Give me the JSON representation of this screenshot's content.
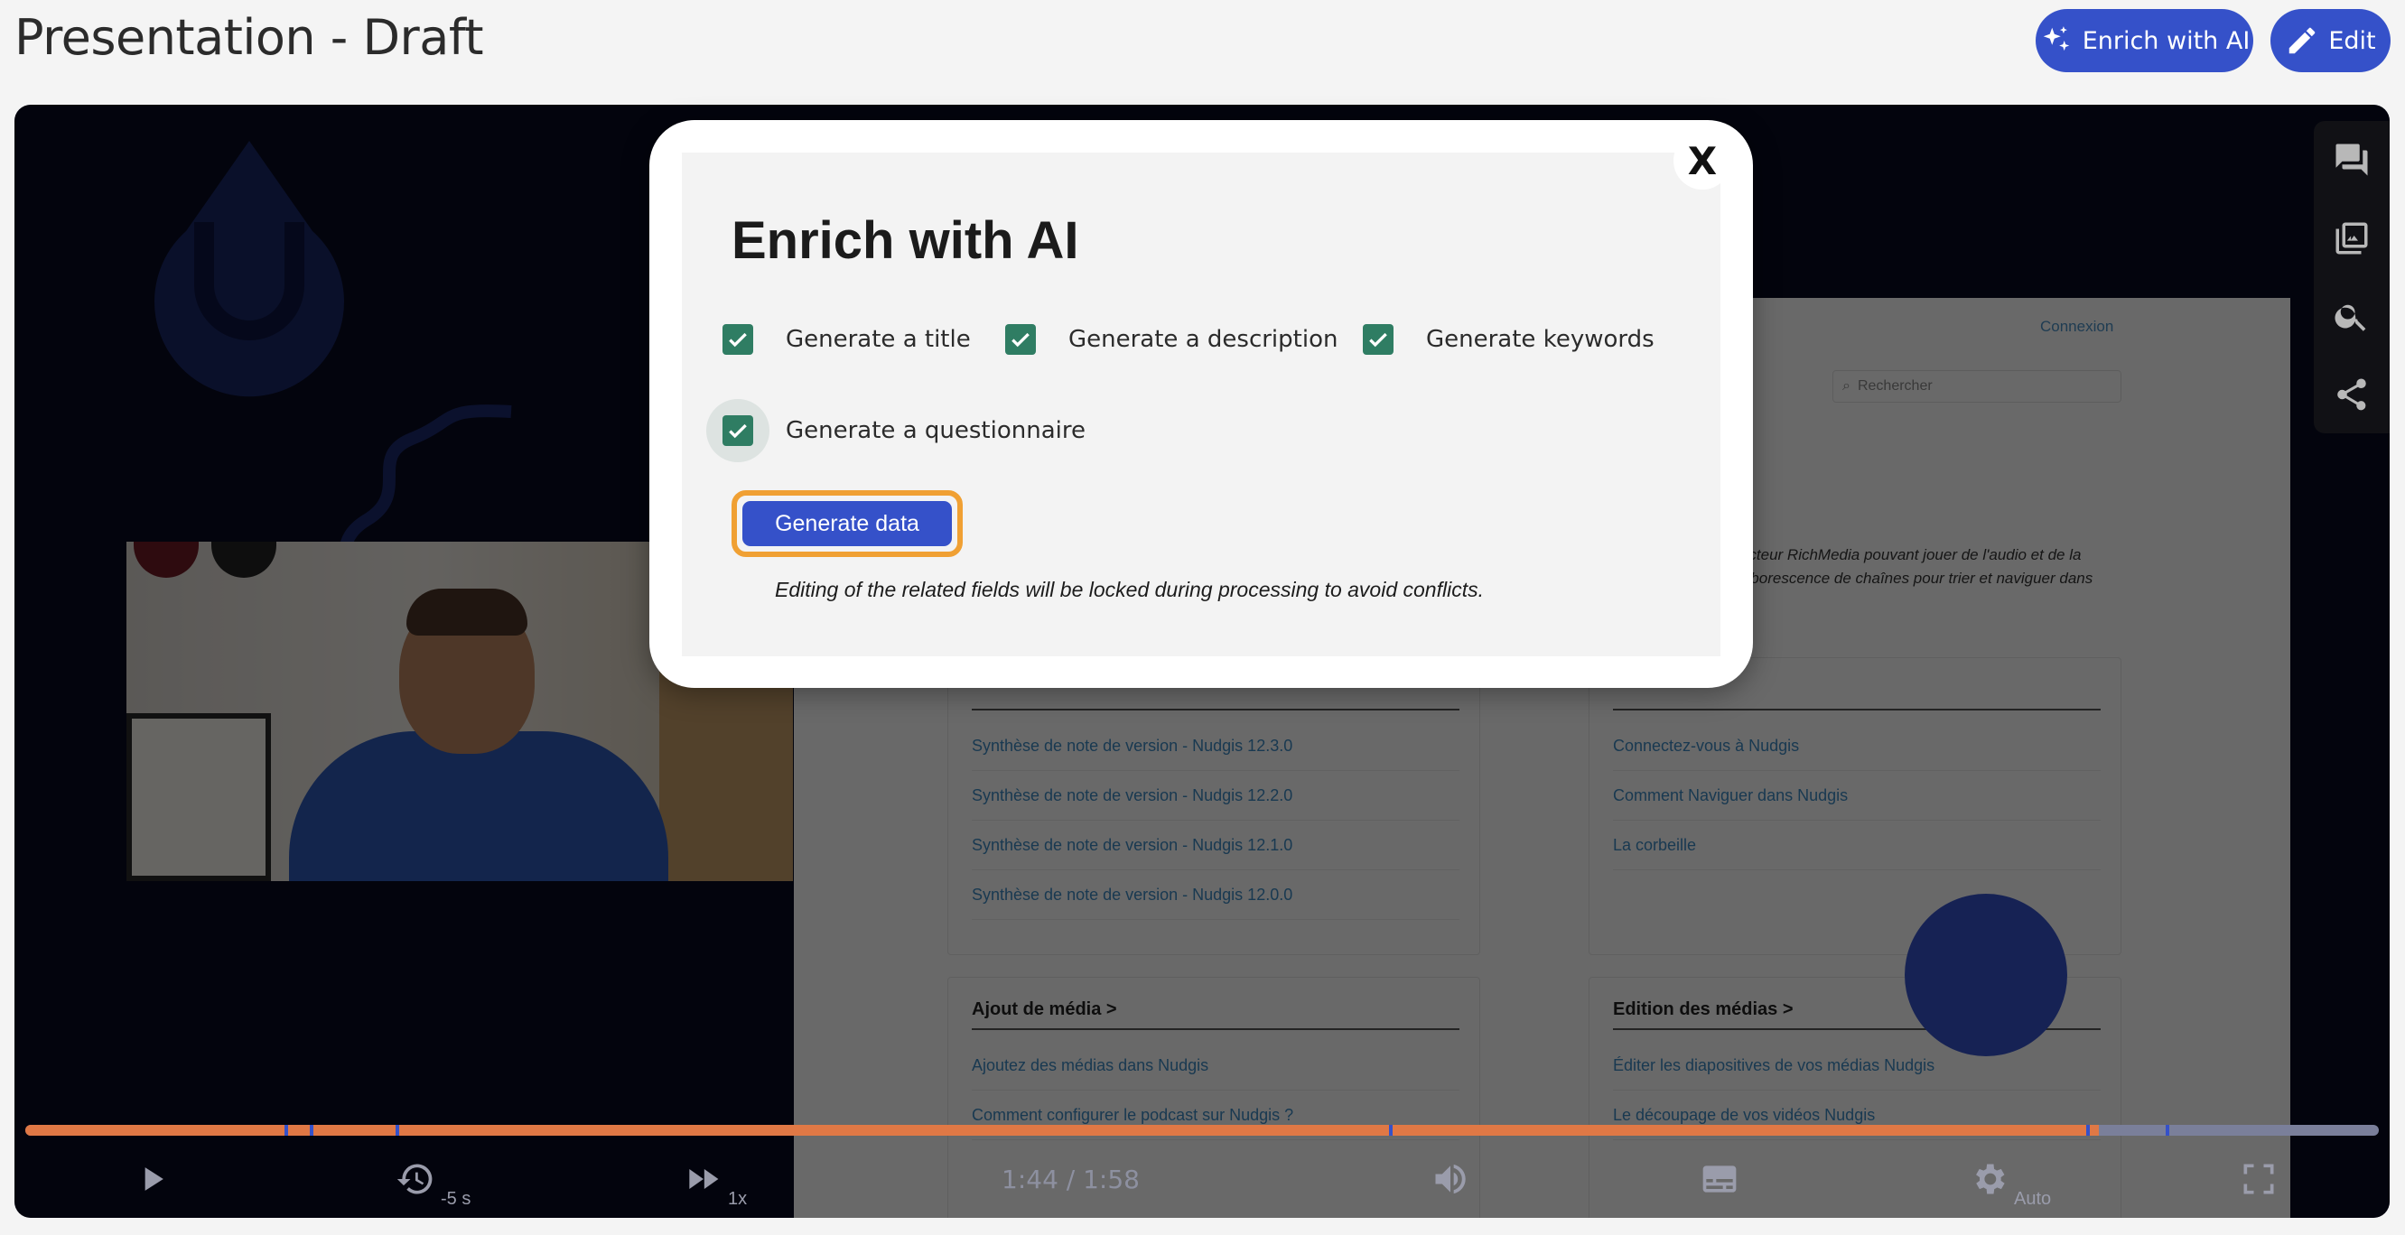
{
  "header": {
    "title": "Presentation - Draft",
    "enrich_label": "Enrich with AI",
    "edit_label": "Edit",
    "accent_color": "#3551c9"
  },
  "player": {
    "slide": {
      "connexion": "Connexion",
      "search_placeholder": "Rechercher",
      "intro_lines": [
        "n lecteur RichMedia pouvant jouer de l'audio et de la",
        "e arborescence de chaînes pour trier et naviguer dans"
      ],
      "cards": [
        {
          "title": "",
          "links": [
            "Synthèse de note de version - Nudgis 12.3.0",
            "Synthèse de note de version - Nudgis 12.2.0",
            "Synthèse de note de version - Nudgis 12.1.0",
            "Synthèse de note de version - Nudgis 12.0.0"
          ]
        },
        {
          "title": "",
          "links": [
            "Connectez-vous à Nudgis",
            "Comment Naviguer dans Nudgis",
            "La corbeille"
          ]
        },
        {
          "title": "Ajout de média >",
          "links": [
            "Ajoutez des médias dans Nudgis",
            "Comment configurer le podcast sur Nudgis ?"
          ]
        },
        {
          "title": "Edition des médias >",
          "links": [
            "Éditer les diapositives de vos médias Nudgis",
            "Le découpage de vos vidéos Nudgis"
          ]
        }
      ]
    },
    "side_tools": [
      "comments-icon",
      "slides-icon",
      "search-icon",
      "share-icon"
    ],
    "controls": {
      "rewind_label": "-5 s",
      "speed_label": "1x",
      "time": "1:44 / 1:58",
      "quality_label": "Auto",
      "progress_fraction": 0.881
    }
  },
  "modal": {
    "close_label": "X",
    "title": "Enrich with AI",
    "options": [
      {
        "label": "Generate a title",
        "checked": true
      },
      {
        "label": "Generate a description",
        "checked": true
      },
      {
        "label": "Generate keywords",
        "checked": true
      },
      {
        "label": "Generate a questionnaire",
        "checked": true
      }
    ],
    "generate_button": "Generate data",
    "note": "Editing of the related fields will be locked during processing to avoid conflicts.",
    "checkbox_color": "#2f7d63",
    "focus_ring_color": "#f0a033"
  }
}
